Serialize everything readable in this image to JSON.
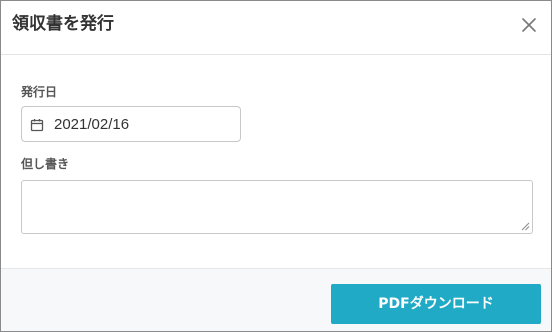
{
  "dialog": {
    "title": "領収書を発行",
    "close_icon": "close-icon"
  },
  "form": {
    "issue_date": {
      "label": "発行日",
      "value": "2021/02/16",
      "icon": "calendar-icon"
    },
    "note": {
      "label": "但し書き",
      "value": ""
    }
  },
  "footer": {
    "download_label": "PDFダウンロード"
  },
  "colors": {
    "accent": "#20aac6",
    "text": "#333333",
    "border": "#c8c8c8",
    "footer_bg": "#f7f8f9"
  }
}
